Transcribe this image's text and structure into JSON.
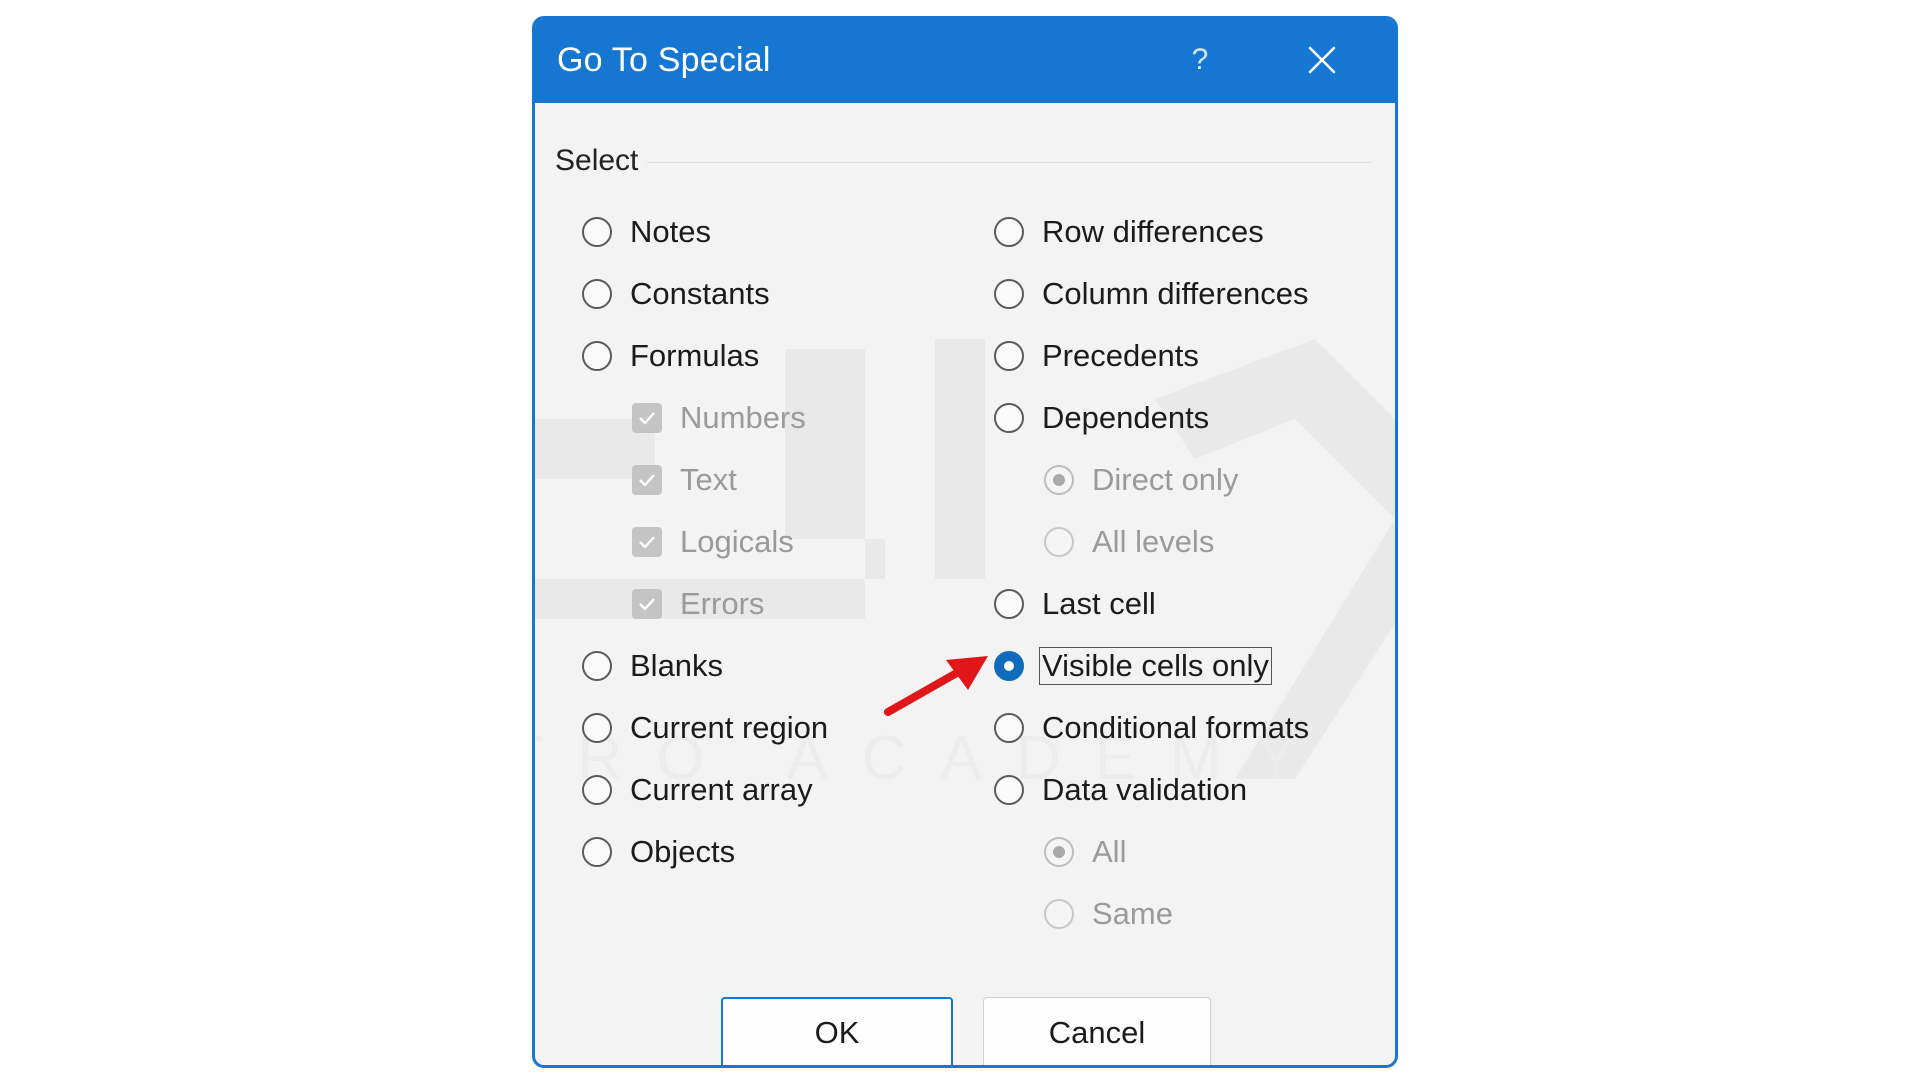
{
  "dialog": {
    "title": "Go To Special",
    "help_label": "?",
    "group_label": "Select"
  },
  "left_options": [
    {
      "label": "Notes",
      "selected": false,
      "enabled": true
    },
    {
      "label": "Constants",
      "selected": false,
      "enabled": true
    },
    {
      "label": "Formulas",
      "selected": false,
      "enabled": true
    },
    {
      "label": "Blanks",
      "selected": false,
      "enabled": true
    },
    {
      "label": "Current region",
      "selected": false,
      "enabled": true
    },
    {
      "label": "Current array",
      "selected": false,
      "enabled": true
    },
    {
      "label": "Objects",
      "selected": false,
      "enabled": true
    }
  ],
  "formula_checkboxes": [
    {
      "label": "Numbers",
      "checked": true,
      "enabled": false
    },
    {
      "label": "Text",
      "checked": true,
      "enabled": false
    },
    {
      "label": "Logicals",
      "checked": true,
      "enabled": false
    },
    {
      "label": "Errors",
      "checked": true,
      "enabled": false
    }
  ],
  "right_options": [
    {
      "label": "Row differences",
      "selected": false,
      "enabled": true
    },
    {
      "label": "Column differences",
      "selected": false,
      "enabled": true
    },
    {
      "label": "Precedents",
      "selected": false,
      "enabled": true
    },
    {
      "label": "Dependents",
      "selected": false,
      "enabled": true
    },
    {
      "label": "Last cell",
      "selected": false,
      "enabled": true
    },
    {
      "label": "Visible cells only",
      "selected": true,
      "enabled": true
    },
    {
      "label": "Conditional formats",
      "selected": false,
      "enabled": true
    },
    {
      "label": "Data validation",
      "selected": false,
      "enabled": true
    }
  ],
  "dependents_sub": [
    {
      "label": "Direct only",
      "selected": true,
      "enabled": false
    },
    {
      "label": "All levels",
      "selected": false,
      "enabled": false
    }
  ],
  "validation_sub": [
    {
      "label": "All",
      "selected": true,
      "enabled": false
    },
    {
      "label": "Same",
      "selected": false,
      "enabled": false
    }
  ],
  "buttons": {
    "ok": "OK",
    "cancel": "Cancel"
  },
  "watermark": {
    "text": "ATRO ACADEMY"
  },
  "colors": {
    "accent": "#1677d2",
    "selected_radio": "#0f6cbd",
    "annotation_arrow": "#e0161b"
  }
}
